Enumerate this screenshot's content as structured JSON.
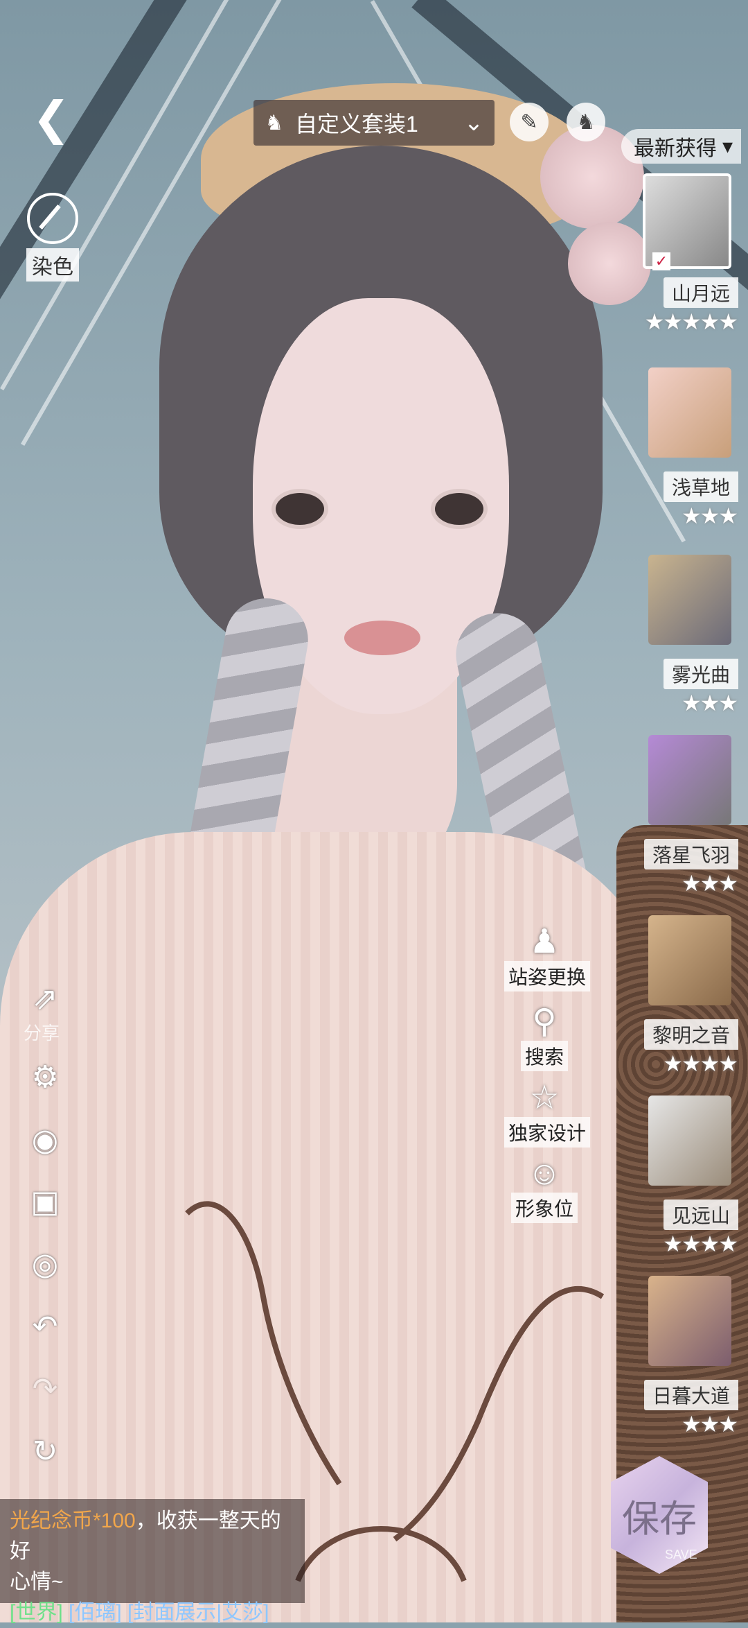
{
  "header": {
    "outfit_name": "自定义套装1",
    "sort_label": "最新获得"
  },
  "left_top": {
    "dye_label": "染色"
  },
  "side_tools": {
    "share_label": "分享"
  },
  "items": [
    {
      "name": "山月远",
      "stars": 5,
      "selected": true
    },
    {
      "name": "浅草地",
      "stars": 3,
      "selected": false
    },
    {
      "name": "雾光曲",
      "stars": 3,
      "selected": false
    },
    {
      "name": "落星飞羽",
      "stars": 3,
      "selected": false
    },
    {
      "name": "黎明之音",
      "stars": 4,
      "selected": false
    },
    {
      "name": "见远山",
      "stars": 4,
      "selected": false
    },
    {
      "name": "日暮大道",
      "stars": 3,
      "selected": false
    }
  ],
  "middle_actions": {
    "pose_label": "站姿更换",
    "search_label": "搜索",
    "exclusive_label": "独家设计",
    "image_slot_label": "形象位"
  },
  "chat": {
    "coin_text": "光纪念币*100",
    "message_rest": "，收获一整天的好",
    "message_line2": "心情~",
    "channel": "[世界]",
    "user": "[佰璃]",
    "cover_link": "[封面展示|艾莎]"
  },
  "save": {
    "label": "保存",
    "sub_label": "SAVE"
  }
}
